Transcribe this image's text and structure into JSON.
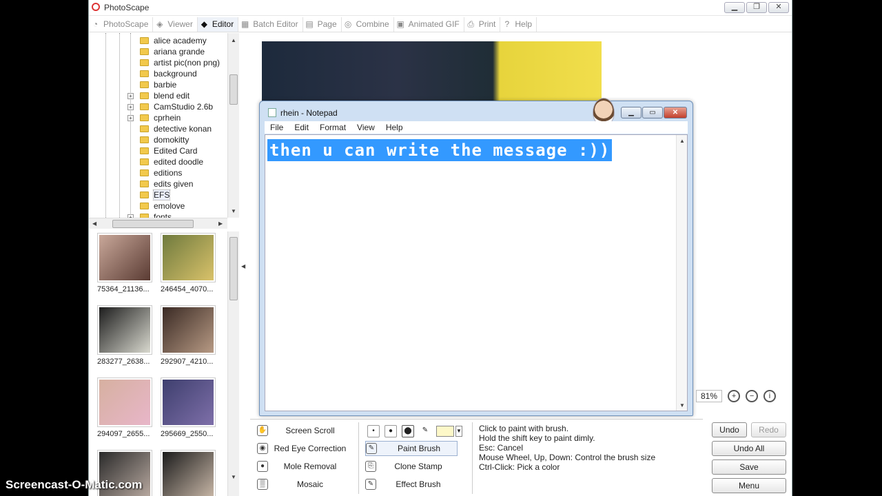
{
  "app": {
    "title": "PhotoScape"
  },
  "tabs": [
    {
      "label": "PhotoScape",
      "icon": "photoscape-icon"
    },
    {
      "label": "Viewer",
      "icon": "viewer-icon"
    },
    {
      "label": "Editor",
      "icon": "editor-icon",
      "active": true
    },
    {
      "label": "Batch Editor",
      "icon": "batch-icon"
    },
    {
      "label": "Page",
      "icon": "page-icon"
    },
    {
      "label": "Combine",
      "icon": "combine-icon"
    },
    {
      "label": "Animated GIF",
      "icon": "gif-icon"
    },
    {
      "label": "Print",
      "icon": "print-icon"
    },
    {
      "label": "Help",
      "icon": "help-icon"
    }
  ],
  "folders": [
    {
      "name": "alice academy",
      "expandable": false
    },
    {
      "name": "ariana grande",
      "expandable": false
    },
    {
      "name": "artist pic(non png)",
      "expandable": false
    },
    {
      "name": "background",
      "expandable": false
    },
    {
      "name": "barbie",
      "expandable": false
    },
    {
      "name": "blend edit",
      "expandable": true
    },
    {
      "name": "CamStudio 2.6b",
      "expandable": true
    },
    {
      "name": "cprhein",
      "expandable": true
    },
    {
      "name": "detective konan",
      "expandable": false
    },
    {
      "name": "domokitty",
      "expandable": false
    },
    {
      "name": "Edited Card",
      "expandable": false
    },
    {
      "name": "edited doodle",
      "expandable": false
    },
    {
      "name": "editions",
      "expandable": false
    },
    {
      "name": "edits given",
      "expandable": false
    },
    {
      "name": "EFS",
      "expandable": false,
      "selected": true
    },
    {
      "name": "emolove",
      "expandable": false
    },
    {
      "name": "fonts",
      "expandable": true
    }
  ],
  "thumbnails": [
    {
      "caption": "75364_21136...",
      "colors": [
        "#c9a89a",
        "#5a3b33"
      ]
    },
    {
      "caption": "246454_4070...",
      "colors": [
        "#6f7a3e",
        "#d9c26a"
      ]
    },
    {
      "caption": "283277_2638...",
      "colors": [
        "#1d1d1d",
        "#d9d9cf"
      ]
    },
    {
      "caption": "292907_4210...",
      "colors": [
        "#3a2a24",
        "#b79a84"
      ]
    },
    {
      "caption": "294097_2655...",
      "colors": [
        "#d6b0a0",
        "#e8b6c9"
      ]
    },
    {
      "caption": "295669_2550...",
      "colors": [
        "#3e3f6e",
        "#7e6fa9"
      ]
    },
    {
      "caption": "",
      "colors": [
        "#2a2a2a",
        "#b8a9a0"
      ]
    },
    {
      "caption": "",
      "colors": [
        "#1c1c1c",
        "#c7b6a6"
      ]
    }
  ],
  "notepad": {
    "title": "rhein - Notepad",
    "menu": [
      "File",
      "Edit",
      "Format",
      "View",
      "Help"
    ],
    "text": "then u can write the message :))"
  },
  "zoom": {
    "value": "81%"
  },
  "tools_left": [
    "Screen Scroll",
    "Red Eye Correction",
    "Mole Removal",
    "Mosaic"
  ],
  "tools_right": [
    "Paint Brush",
    "Clone Stamp",
    "Effect Brush"
  ],
  "help_lines": [
    "Click to paint with brush.",
    "Hold the shift key to paint dimly.",
    "Esc: Cancel",
    "Mouse Wheel, Up, Down: Control the brush size",
    "Ctrl-Click: Pick a color"
  ],
  "buttons": {
    "undo": "Undo",
    "redo": "Redo",
    "undo_all": "Undo All",
    "save": "Save",
    "menu": "Menu"
  },
  "brush_color": "#fdf8c8",
  "watermark": "Screencast-O-Matic.com"
}
